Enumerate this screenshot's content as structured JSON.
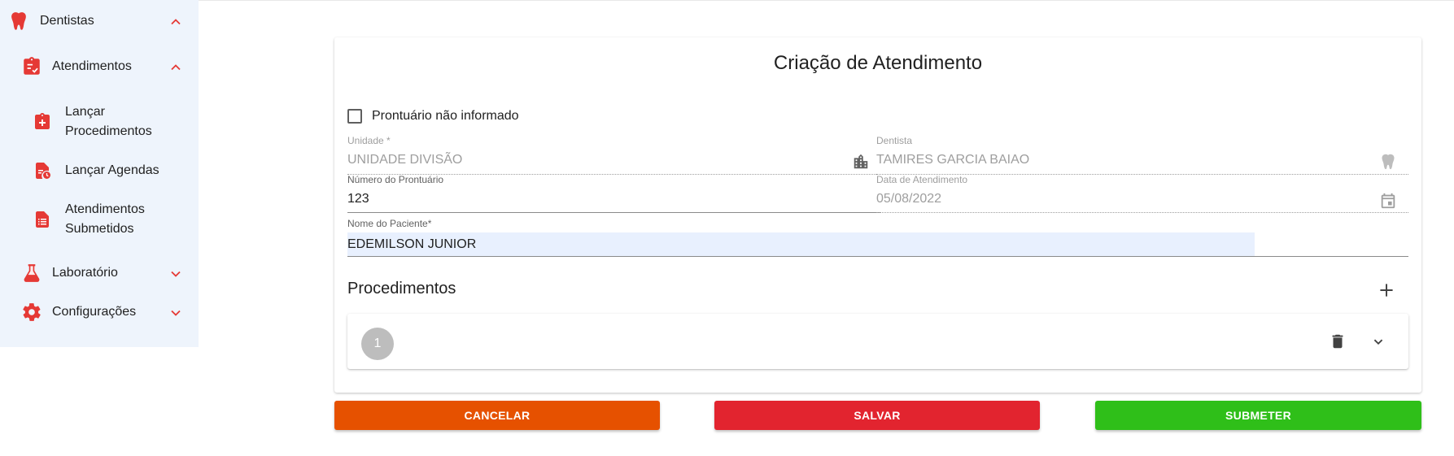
{
  "sidebar": {
    "top_item": {
      "label": "Dentistas",
      "icon": "tooth-icon"
    },
    "group": {
      "label": "Atendimentos",
      "icon": "clipboard-check-icon"
    },
    "sub_items": [
      {
        "label_line1": "Lançar",
        "label_line2": "Procedimentos",
        "icon": "clipboard-plus-icon"
      },
      {
        "label_line1": "Lançar Agendas",
        "label_line2": "",
        "icon": "document-clock-icon"
      },
      {
        "label_line1": "Atendimentos",
        "label_line2": "Submetidos",
        "icon": "document-list-icon"
      }
    ],
    "laboratorio": {
      "label": "Laboratório",
      "icon": "flask-icon"
    },
    "configuracoes": {
      "label": "Configurações",
      "icon": "gear-icon"
    }
  },
  "form": {
    "title": "Criação de Atendimento",
    "checkbox_label": "Prontuário não informado",
    "unidade": {
      "label": "Unidade *",
      "value": "UNIDADE DIVISÃO"
    },
    "dentista": {
      "label": "Dentista",
      "value": "TAMIRES GARCIA BAIAO"
    },
    "numero_prontuario": {
      "label": "Número do Prontuário",
      "value": "123"
    },
    "data_atendimento": {
      "label": "Data de Atendimento",
      "value": "05/08/2022"
    },
    "nome_paciente": {
      "label": "Nome do Paciente*",
      "value": "EDEMILSON JUNIOR"
    },
    "procedimentos_title": "Procedimentos",
    "procedure_step": "1"
  },
  "actions": {
    "cancel": "CANCELAR",
    "save": "SALVAR",
    "submit": "SUBMETER"
  },
  "colors": {
    "accent_red": "#e53935",
    "cancel": "#e65100",
    "save": "#e2242f",
    "submit": "#2fbf19",
    "sidebar_bg": "#eef4fc"
  }
}
